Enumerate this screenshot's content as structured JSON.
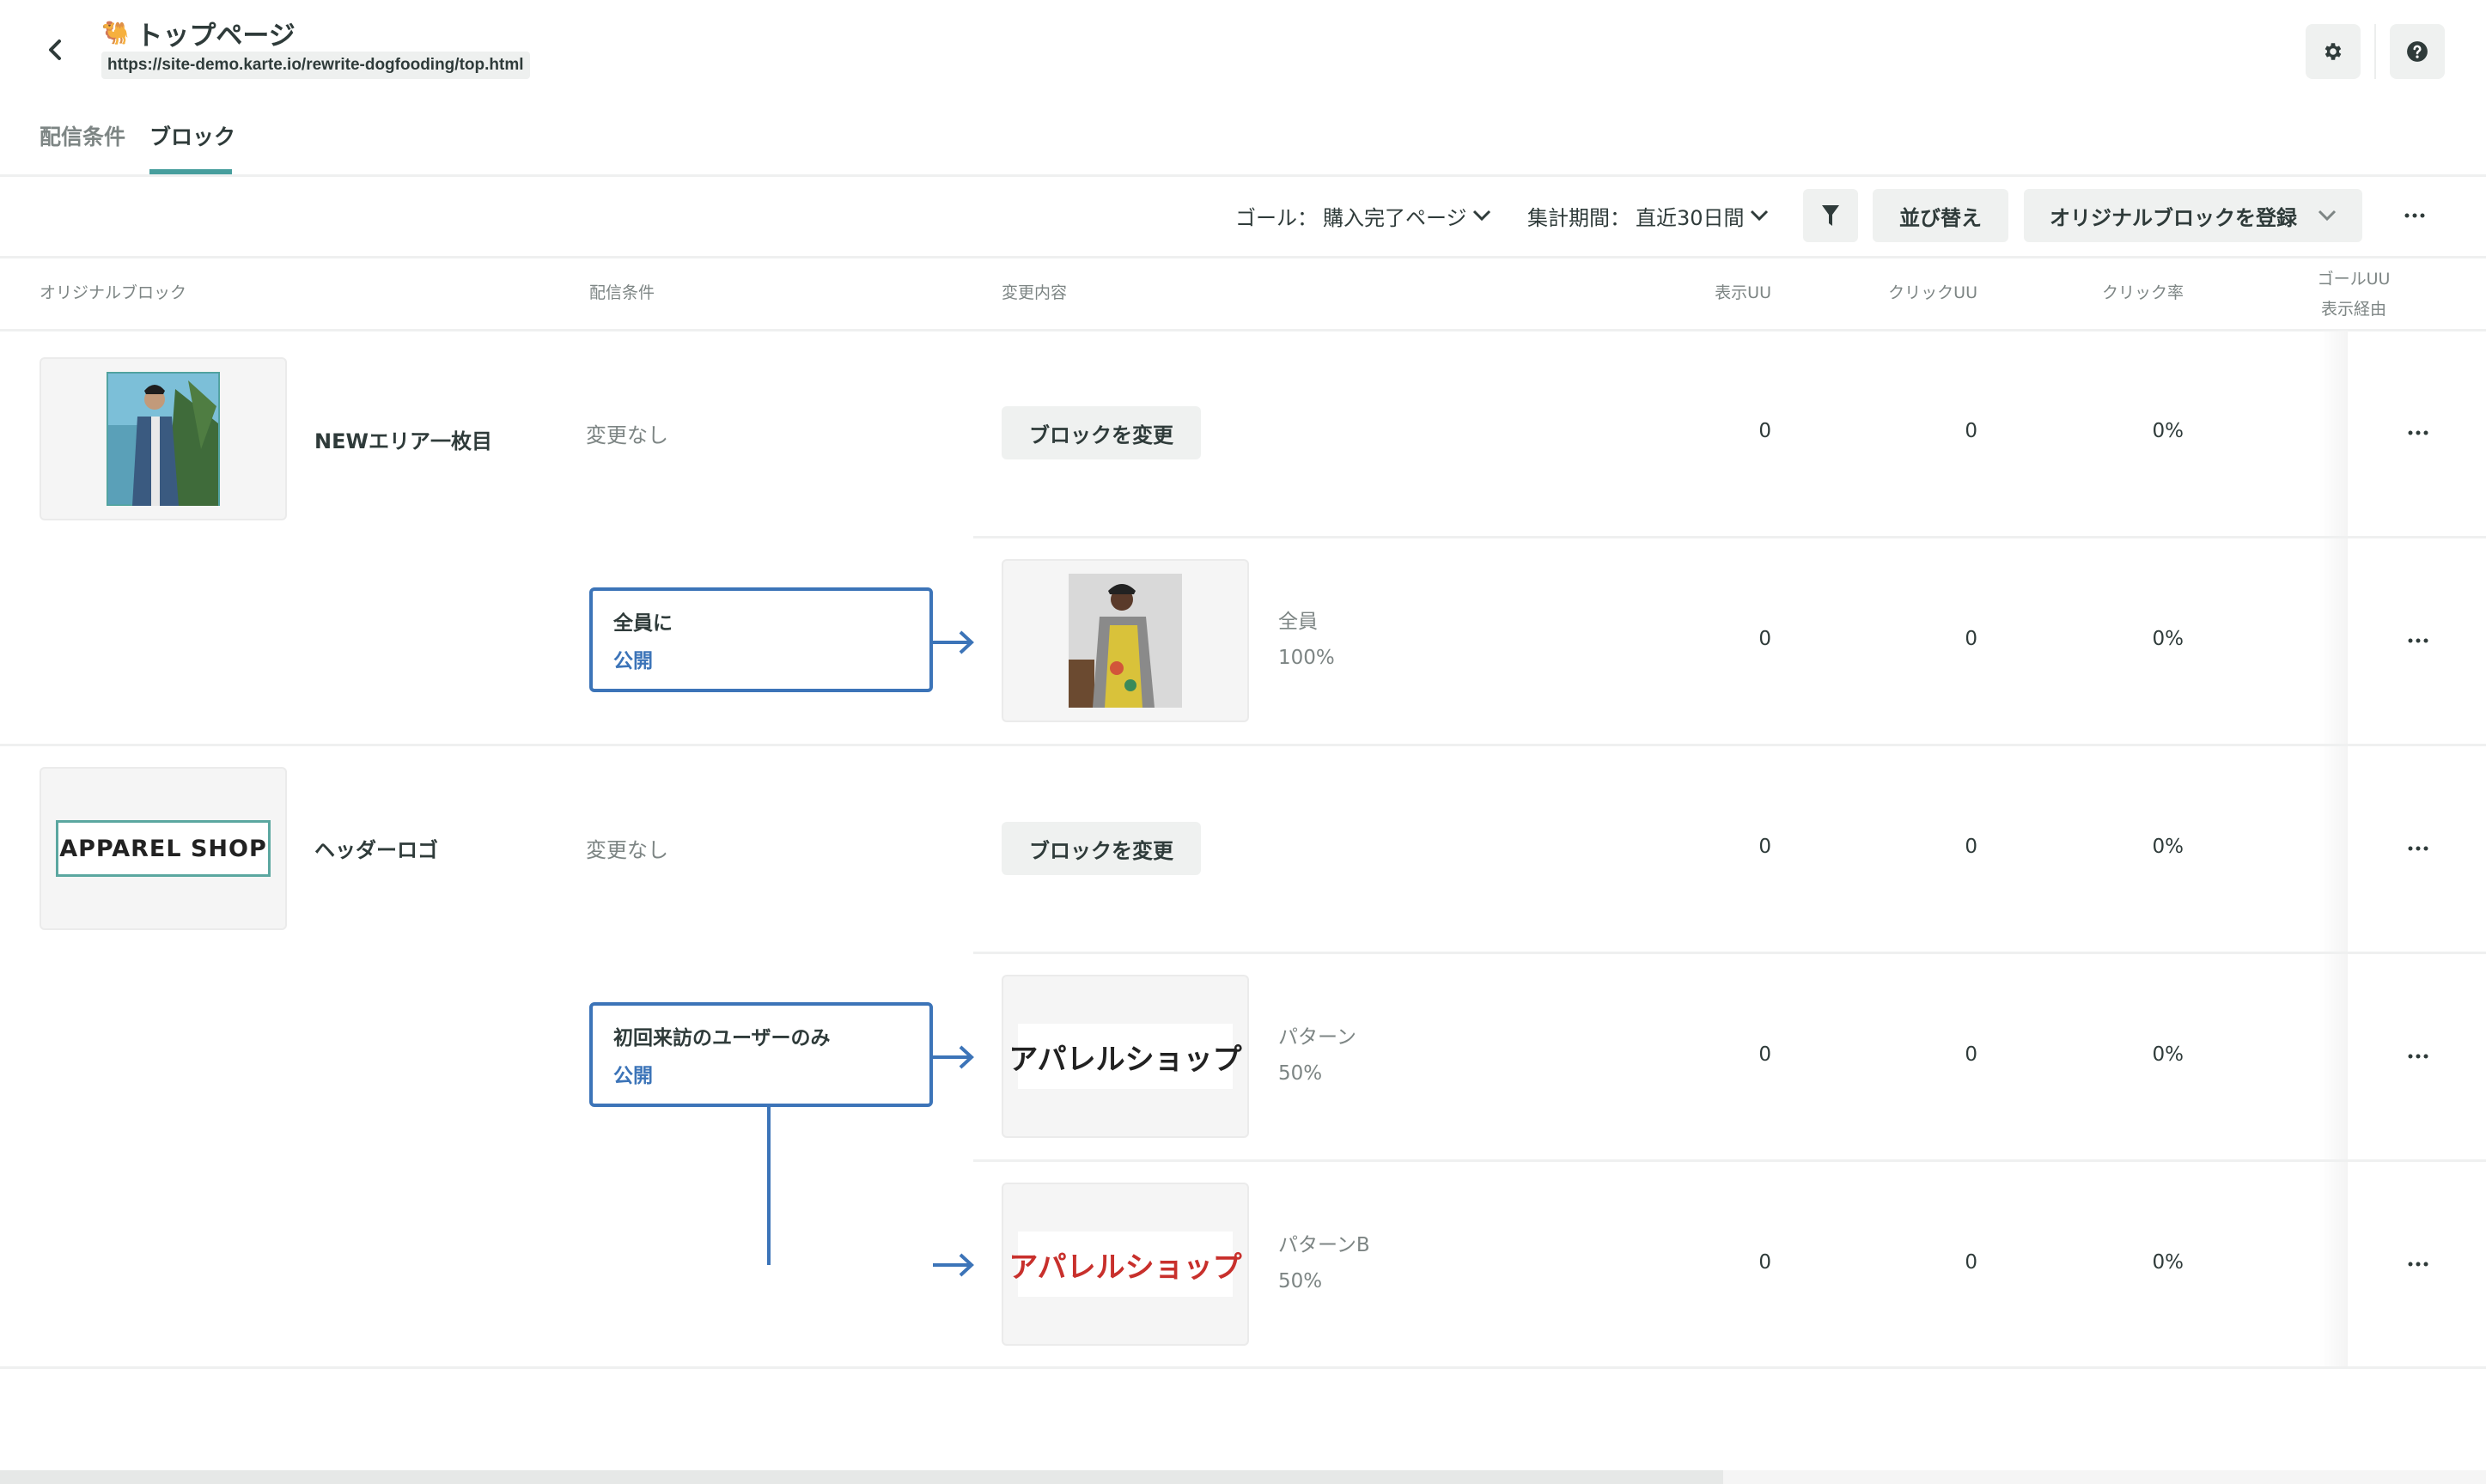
{
  "header": {
    "title": "トップページ",
    "title_emoji": "🐫",
    "url": "https://site-demo.karte.io/rewrite-dogfooding/top.html"
  },
  "tabs": [
    {
      "label": "配信条件",
      "active": false
    },
    {
      "label": "ブロック",
      "active": true
    }
  ],
  "toolbar": {
    "goal_label": "ゴール：",
    "goal_value": "購入完了ページ",
    "period_label": "集計期間：",
    "period_value": "直近30日間",
    "sort_label": "並び替え",
    "register_label": "オリジナルブロックを登録"
  },
  "columns": {
    "original_block": "オリジナルブロック",
    "conditions": "配信条件",
    "changes": "変更内容",
    "display_uu": "表示UU",
    "click_uu": "クリックUU",
    "click_rate": "クリック率",
    "goal_uu_line1": "ゴールUU",
    "goal_uu_line2": "表示経由"
  },
  "blocks": [
    {
      "name": "NEWエリア一枚目",
      "thumbnail": "man-denim-jacket-palm-photo",
      "default_row": {
        "condition": "変更なし",
        "action_label": "ブロックを変更",
        "display_uu": "0",
        "click_uu": "0",
        "click_rate": "0%"
      },
      "conditions": [
        {
          "title": "全員に",
          "status": "公開",
          "variants": [
            {
              "thumbnail": "woman-floral-dress-photo",
              "label": "全員",
              "share": "100%",
              "display_uu": "0",
              "click_uu": "0",
              "click_rate": "0%"
            }
          ]
        }
      ]
    },
    {
      "name": "ヘッダーロゴ",
      "thumbnail_text": "APPAREL SHOP",
      "default_row": {
        "condition": "変更なし",
        "action_label": "ブロックを変更",
        "display_uu": "0",
        "click_uu": "0",
        "click_rate": "0%"
      },
      "conditions": [
        {
          "title": "初回来訪のユーザーのみ",
          "status": "公開",
          "variants": [
            {
              "thumbnail_text": "アパレルショップ",
              "thumbnail_color": "#222222",
              "label": "パターン",
              "share": "50%",
              "display_uu": "0",
              "click_uu": "0",
              "click_rate": "0%"
            },
            {
              "thumbnail_text": "アパレルショップ",
              "thumbnail_color": "#c8302c",
              "label": "パターンB",
              "share": "50%",
              "display_uu": "0",
              "click_uu": "0",
              "click_rate": "0%"
            }
          ]
        }
      ]
    }
  ],
  "colors": {
    "accent_teal": "#479e9d",
    "condition_blue": "#3c74b8",
    "text_primary": "#2f3b3a",
    "text_muted": "#7d8584",
    "button_bg": "#eff1f0"
  }
}
